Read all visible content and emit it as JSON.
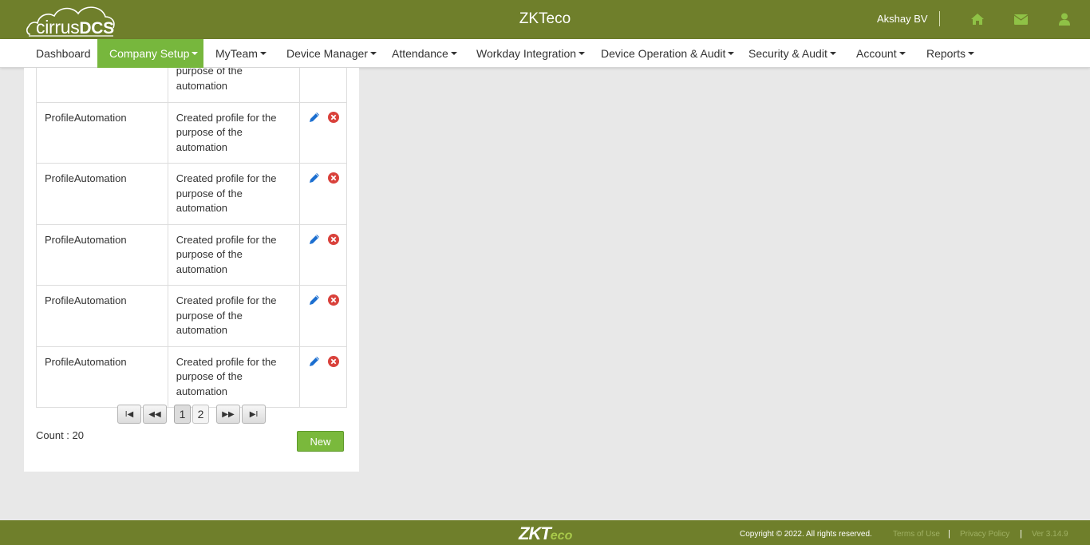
{
  "brand": {
    "logo_light": "cirrus",
    "logo_bold": "DCS",
    "app_title": "ZKTeco"
  },
  "user": {
    "name": "Akshay BV"
  },
  "header_icons": [
    "home-icon",
    "envelope-icon",
    "user-icon"
  ],
  "nav": {
    "items": [
      {
        "label": "Dashboard"
      },
      {
        "label": "Company Setup"
      },
      {
        "label": "MyTeam"
      },
      {
        "label": "Device Manager"
      },
      {
        "label": "Attendance"
      },
      {
        "label": "Workday Integration"
      },
      {
        "label": "Device Operation & Audit"
      },
      {
        "label": "Security & Audit"
      },
      {
        "label": "Account"
      },
      {
        "label": "Reports"
      }
    ],
    "active": "Company Setup"
  },
  "table": {
    "partial_row_desc": "automation",
    "rows": [
      {
        "name": "ProfileAutomation",
        "desc_l1": "Created profile for the",
        "desc_l2": "purpose of the",
        "desc_l3": "automation"
      },
      {
        "name": "ProfileAutomation",
        "desc_l1": "Created profile for the",
        "desc_l2": "purpose of the",
        "desc_l3": "automation"
      },
      {
        "name": "ProfileAutomation",
        "desc_l1": "Created profile for the",
        "desc_l2": "purpose of the",
        "desc_l3": "automation"
      },
      {
        "name": "ProfileAutomation",
        "desc_l1": "Created profile for the",
        "desc_l2": "purpose of the",
        "desc_l3": "automation"
      },
      {
        "name": "ProfileAutomation",
        "desc_l1": "Created profile for the",
        "desc_l2": "purpose of the",
        "desc_l3": "automation"
      }
    ]
  },
  "pager": {
    "first": "I◀",
    "prev": "◀◀",
    "next": "▶▶",
    "last": "▶I",
    "pages": [
      "1",
      "2"
    ],
    "current": "1"
  },
  "count_label": "Count : 20",
  "new_button": "New",
  "footer": {
    "logo_main": "ZKT",
    "logo_sub": "eco",
    "copyright": "Copyright © 2022. All rights reserved.",
    "terms": "Terms of Use",
    "privacy": "Privacy Policy",
    "version": "Ver 3.14.9",
    "sep": "|"
  },
  "colors": {
    "brand_green": "#6f7f2b",
    "active_green": "#77b73d",
    "edit_blue": "#1c6fd0",
    "delete_red": "#d9413b"
  }
}
